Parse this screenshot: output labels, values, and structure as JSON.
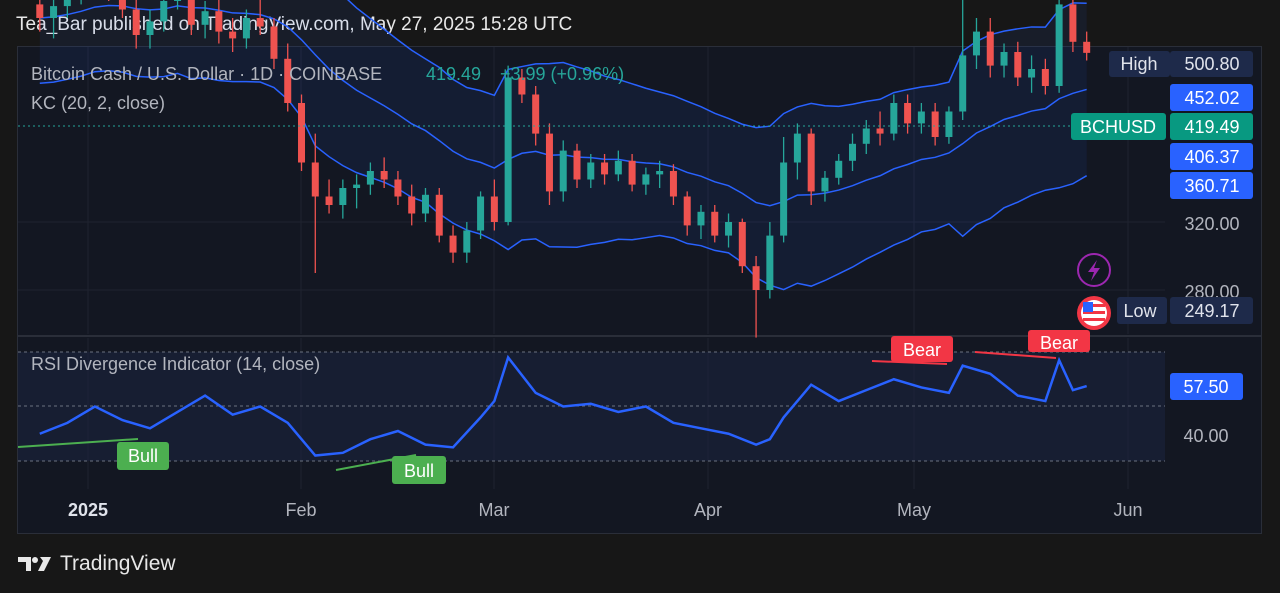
{
  "header": {
    "published": "Tea_Bar published on TradingView.com, May 27, 2025 15:28 UTC"
  },
  "legend": {
    "symbol": "Bitcoin Cash / U.S. Dollar · 1D · COINBASE",
    "price": "419.49",
    "change": "+3.99 (+0.96%)",
    "indicator": "KC (20, 2, close)",
    "rsi_title": "RSI Divergence Indicator (14, close)"
  },
  "price_scale": {
    "high_label": "High",
    "high_value": "500.80",
    "kc_upper": "452.02",
    "ticker": "BCHUSD",
    "last": "419.49",
    "kc_middle": "406.37",
    "kc_lower": "360.71",
    "tick_320": "320.00",
    "tick_280": "280.00",
    "low_label": "Low",
    "low_value": "249.17"
  },
  "rsi_scale": {
    "value": "57.50",
    "tick_40": "40.00"
  },
  "time_axis": [
    "2025",
    "Feb",
    "Mar",
    "Apr",
    "May",
    "Jun"
  ],
  "divergence_labels": {
    "bull_1": "Bull",
    "bull_2": "Bull",
    "bear_1": "Bear",
    "bear_2": "Bear"
  },
  "footer": {
    "brand": "TradingView"
  },
  "colors": {
    "up": "#26a69a",
    "down": "#ef5350",
    "channel": "#2962ff",
    "rsi_line": "#2962ff",
    "bull": "#4caf50",
    "bear": "#f23645",
    "background": "#131722"
  },
  "chart_data": [
    {
      "type": "candlestick",
      "title": "Bitcoin Cash / U.S. Dollar · 1D · COINBASE",
      "indicator": "KC (20, 2, close)",
      "x_range": [
        "2024-12-25",
        "2025-05-27"
      ],
      "ylim": [
        249.17,
        500.8
      ],
      "candles": [
        {
          "d": "2024-12-25",
          "o": 448,
          "h": 456,
          "l": 432,
          "c": 440
        },
        {
          "d": "2024-12-27",
          "o": 440,
          "h": 452,
          "l": 428,
          "c": 447
        },
        {
          "d": "2024-12-29",
          "o": 447,
          "h": 462,
          "l": 440,
          "c": 455
        },
        {
          "d": "2024-12-31",
          "o": 455,
          "h": 472,
          "l": 448,
          "c": 462
        },
        {
          "d": "2025-01-02",
          "o": 462,
          "h": 478,
          "l": 455,
          "c": 470
        },
        {
          "d": "2025-01-04",
          "o": 470,
          "h": 476,
          "l": 450,
          "c": 456
        },
        {
          "d": "2025-01-06",
          "o": 456,
          "h": 468,
          "l": 440,
          "c": 445
        },
        {
          "d": "2025-01-08",
          "o": 445,
          "h": 452,
          "l": 422,
          "c": 430
        },
        {
          "d": "2025-01-10",
          "o": 430,
          "h": 445,
          "l": 422,
          "c": 438
        },
        {
          "d": "2025-01-12",
          "o": 438,
          "h": 458,
          "l": 432,
          "c": 450
        },
        {
          "d": "2025-01-14",
          "o": 450,
          "h": 470,
          "l": 445,
          "c": 465
        },
        {
          "d": "2025-01-16",
          "o": 465,
          "h": 468,
          "l": 430,
          "c": 436
        },
        {
          "d": "2025-01-18",
          "o": 436,
          "h": 450,
          "l": 428,
          "c": 444
        },
        {
          "d": "2025-01-20",
          "o": 444,
          "h": 452,
          "l": 425,
          "c": 432
        },
        {
          "d": "2025-01-22",
          "o": 432,
          "h": 440,
          "l": 420,
          "c": 428
        },
        {
          "d": "2025-01-24",
          "o": 428,
          "h": 445,
          "l": 422,
          "c": 440
        },
        {
          "d": "2025-01-26",
          "o": 440,
          "h": 452,
          "l": 430,
          "c": 435
        },
        {
          "d": "2025-01-28",
          "o": 435,
          "h": 440,
          "l": 410,
          "c": 416
        },
        {
          "d": "2025-01-30",
          "o": 416,
          "h": 425,
          "l": 385,
          "c": 390
        },
        {
          "d": "2025-02-01",
          "o": 390,
          "h": 395,
          "l": 350,
          "c": 355
        },
        {
          "d": "2025-02-03",
          "o": 355,
          "h": 372,
          "l": 290,
          "c": 335
        },
        {
          "d": "2025-02-05",
          "o": 335,
          "h": 345,
          "l": 325,
          "c": 330
        },
        {
          "d": "2025-02-07",
          "o": 330,
          "h": 345,
          "l": 322,
          "c": 340
        },
        {
          "d": "2025-02-09",
          "o": 340,
          "h": 348,
          "l": 328,
          "c": 342
        },
        {
          "d": "2025-02-11",
          "o": 342,
          "h": 355,
          "l": 336,
          "c": 350
        },
        {
          "d": "2025-02-13",
          "o": 350,
          "h": 358,
          "l": 340,
          "c": 345
        },
        {
          "d": "2025-02-15",
          "o": 345,
          "h": 350,
          "l": 330,
          "c": 335
        },
        {
          "d": "2025-02-17",
          "o": 335,
          "h": 342,
          "l": 318,
          "c": 325
        },
        {
          "d": "2025-02-19",
          "o": 325,
          "h": 340,
          "l": 320,
          "c": 336
        },
        {
          "d": "2025-02-21",
          "o": 336,
          "h": 340,
          "l": 308,
          "c": 312
        },
        {
          "d": "2025-02-23",
          "o": 312,
          "h": 318,
          "l": 296,
          "c": 302
        },
        {
          "d": "2025-02-25",
          "o": 302,
          "h": 320,
          "l": 296,
          "c": 315
        },
        {
          "d": "2025-02-27",
          "o": 315,
          "h": 338,
          "l": 310,
          "c": 335
        },
        {
          "d": "2025-03-01",
          "o": 335,
          "h": 345,
          "l": 315,
          "c": 320
        },
        {
          "d": "2025-03-03",
          "o": 320,
          "h": 412,
          "l": 318,
          "c": 405
        },
        {
          "d": "2025-03-05",
          "o": 405,
          "h": 410,
          "l": 390,
          "c": 395
        },
        {
          "d": "2025-03-07",
          "o": 395,
          "h": 400,
          "l": 365,
          "c": 372
        },
        {
          "d": "2025-03-09",
          "o": 372,
          "h": 378,
          "l": 330,
          "c": 338
        },
        {
          "d": "2025-03-11",
          "o": 338,
          "h": 368,
          "l": 332,
          "c": 362
        },
        {
          "d": "2025-03-13",
          "o": 362,
          "h": 366,
          "l": 340,
          "c": 345
        },
        {
          "d": "2025-03-15",
          "o": 345,
          "h": 360,
          "l": 340,
          "c": 355
        },
        {
          "d": "2025-03-17",
          "o": 355,
          "h": 360,
          "l": 342,
          "c": 348
        },
        {
          "d": "2025-03-19",
          "o": 348,
          "h": 362,
          "l": 344,
          "c": 356
        },
        {
          "d": "2025-03-21",
          "o": 356,
          "h": 360,
          "l": 338,
          "c": 342
        },
        {
          "d": "2025-03-23",
          "o": 342,
          "h": 352,
          "l": 336,
          "c": 348
        },
        {
          "d": "2025-03-25",
          "o": 348,
          "h": 356,
          "l": 340,
          "c": 350
        },
        {
          "d": "2025-03-27",
          "o": 350,
          "h": 354,
          "l": 330,
          "c": 335
        },
        {
          "d": "2025-03-29",
          "o": 335,
          "h": 338,
          "l": 312,
          "c": 318
        },
        {
          "d": "2025-03-31",
          "o": 318,
          "h": 330,
          "l": 310,
          "c": 326
        },
        {
          "d": "2025-04-02",
          "o": 326,
          "h": 330,
          "l": 308,
          "c": 312
        },
        {
          "d": "2025-04-04",
          "o": 312,
          "h": 325,
          "l": 305,
          "c": 320
        },
        {
          "d": "2025-04-06",
          "o": 320,
          "h": 322,
          "l": 290,
          "c": 294
        },
        {
          "d": "2025-04-08",
          "o": 294,
          "h": 300,
          "l": 252,
          "c": 280
        },
        {
          "d": "2025-04-10",
          "o": 280,
          "h": 320,
          "l": 275,
          "c": 312
        },
        {
          "d": "2025-04-12",
          "o": 312,
          "h": 370,
          "l": 308,
          "c": 355
        },
        {
          "d": "2025-04-14",
          "o": 355,
          "h": 378,
          "l": 345,
          "c": 372
        },
        {
          "d": "2025-04-16",
          "o": 372,
          "h": 375,
          "l": 330,
          "c": 338
        },
        {
          "d": "2025-04-18",
          "o": 338,
          "h": 350,
          "l": 332,
          "c": 346
        },
        {
          "d": "2025-04-20",
          "o": 346,
          "h": 360,
          "l": 342,
          "c": 356
        },
        {
          "d": "2025-04-22",
          "o": 356,
          "h": 372,
          "l": 350,
          "c": 366
        },
        {
          "d": "2025-04-24",
          "o": 366,
          "h": 380,
          "l": 360,
          "c": 375
        },
        {
          "d": "2025-04-26",
          "o": 375,
          "h": 385,
          "l": 365,
          "c": 372
        },
        {
          "d": "2025-04-28",
          "o": 372,
          "h": 395,
          "l": 368,
          "c": 390
        },
        {
          "d": "2025-04-30",
          "o": 390,
          "h": 395,
          "l": 372,
          "c": 378
        },
        {
          "d": "2025-05-02",
          "o": 378,
          "h": 390,
          "l": 372,
          "c": 385
        },
        {
          "d": "2025-05-04",
          "o": 385,
          "h": 390,
          "l": 365,
          "c": 370
        },
        {
          "d": "2025-05-06",
          "o": 370,
          "h": 388,
          "l": 366,
          "c": 385
        },
        {
          "d": "2025-05-08",
          "o": 385,
          "h": 490,
          "l": 380,
          "c": 418
        },
        {
          "d": "2025-05-10",
          "o": 418,
          "h": 440,
          "l": 410,
          "c": 432
        },
        {
          "d": "2025-05-12",
          "o": 432,
          "h": 440,
          "l": 405,
          "c": 412
        },
        {
          "d": "2025-05-14",
          "o": 412,
          "h": 425,
          "l": 405,
          "c": 420
        },
        {
          "d": "2025-05-16",
          "o": 420,
          "h": 426,
          "l": 400,
          "c": 405
        },
        {
          "d": "2025-05-18",
          "o": 405,
          "h": 418,
          "l": 396,
          "c": 410
        },
        {
          "d": "2025-05-20",
          "o": 410,
          "h": 416,
          "l": 395,
          "c": 400
        },
        {
          "d": "2025-05-22",
          "o": 400,
          "h": 455,
          "l": 396,
          "c": 448
        },
        {
          "d": "2025-05-24",
          "o": 448,
          "h": 458,
          "l": 420,
          "c": 426
        },
        {
          "d": "2025-05-26",
          "o": 426,
          "h": 432,
          "l": 415,
          "c": 419.49
        }
      ],
      "kc_last": {
        "upper": 452.02,
        "middle": 406.37,
        "lower": 360.71
      },
      "price_ticks": [
        320,
        280
      ]
    },
    {
      "type": "line",
      "title": "RSI Divergence Indicator (14, close)",
      "ylim": [
        30,
        70
      ],
      "reference_lines": [
        70,
        30
      ],
      "x": [
        "2024-12-25",
        "2024-12-29",
        "2025-01-02",
        "2025-01-06",
        "2025-01-10",
        "2025-01-14",
        "2025-01-18",
        "2025-01-22",
        "2025-01-26",
        "2025-01-30",
        "2025-02-03",
        "2025-02-07",
        "2025-02-11",
        "2025-02-15",
        "2025-02-19",
        "2025-02-23",
        "2025-02-27",
        "2025-03-01",
        "2025-03-03",
        "2025-03-07",
        "2025-03-11",
        "2025-03-15",
        "2025-03-19",
        "2025-03-23",
        "2025-03-27",
        "2025-03-31",
        "2025-04-04",
        "2025-04-08",
        "2025-04-10",
        "2025-04-12",
        "2025-04-16",
        "2025-04-20",
        "2025-04-24",
        "2025-04-28",
        "2025-05-02",
        "2025-05-06",
        "2025-05-08",
        "2025-05-12",
        "2025-05-16",
        "2025-05-20",
        "2025-05-22",
        "2025-05-24",
        "2025-05-26"
      ],
      "values": [
        40,
        44,
        50,
        45,
        42,
        48,
        54,
        47,
        50,
        44,
        32,
        33,
        38,
        41,
        36,
        35,
        46,
        52,
        68,
        55,
        50,
        51,
        48,
        50,
        44,
        42,
        40,
        36,
        38,
        46,
        58,
        52,
        56,
        60,
        57,
        55,
        65,
        62,
        54,
        52,
        67,
        56,
        57.5
      ],
      "divergences": [
        {
          "label": "Bull",
          "from": "2024-12-25",
          "to": "2025-01-14"
        },
        {
          "label": "Bull",
          "from": "2025-02-05",
          "to": "2025-02-19"
        },
        {
          "label": "Bear",
          "from": "2025-04-24",
          "to": "2025-05-02"
        },
        {
          "label": "Bear",
          "from": "2025-05-08",
          "to": "2025-05-22"
        }
      ]
    }
  ]
}
